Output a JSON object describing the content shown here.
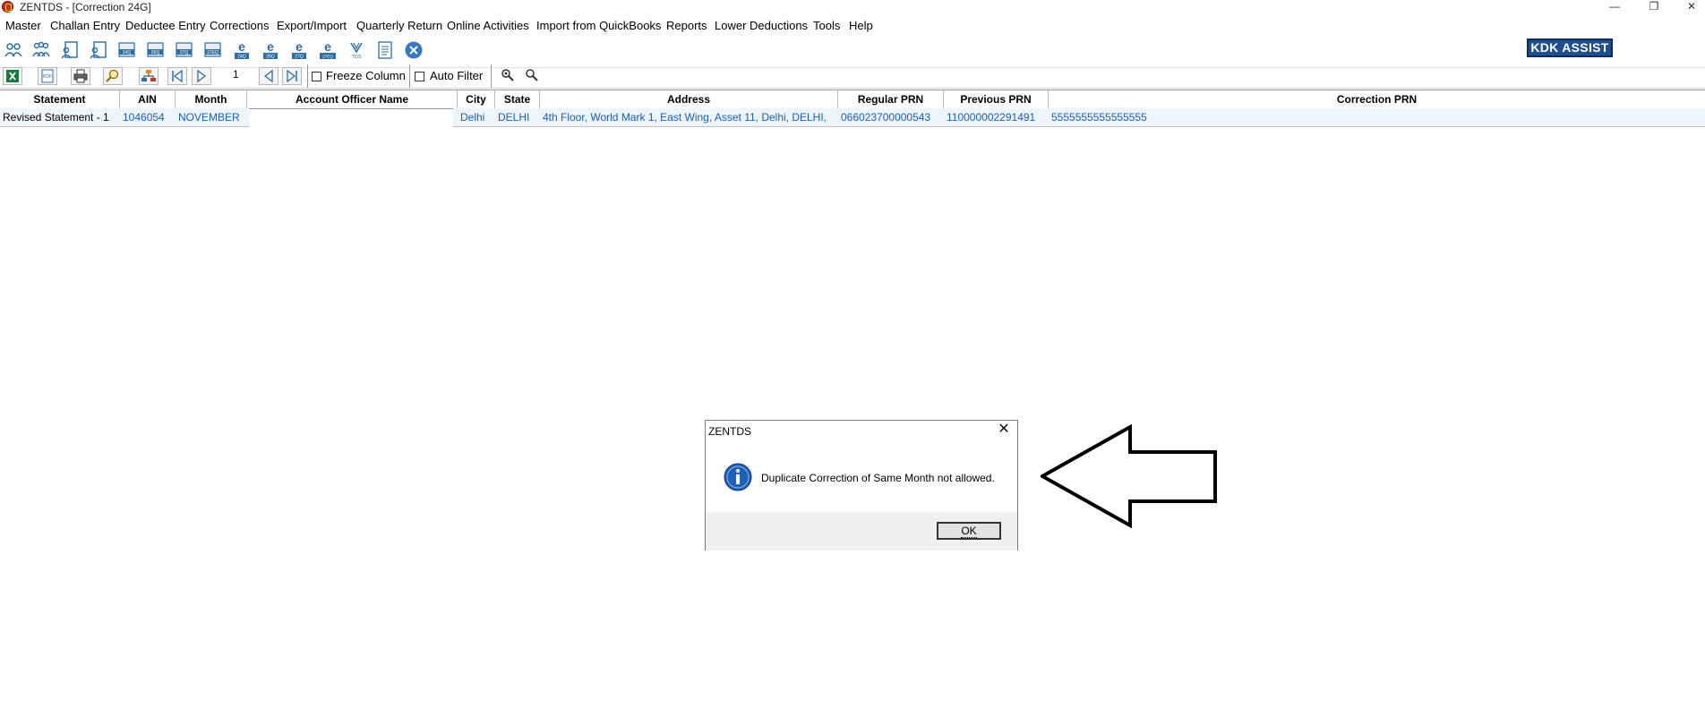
{
  "window": {
    "title": "ZENTDS - [Correction 24G]",
    "minimize": "—",
    "restore": "❐",
    "close": "✕"
  },
  "menu": [
    "Master",
    "Challan Entry",
    "Deductee Entry",
    "Corrections",
    "Export/Import",
    "Quarterly Return",
    "Online Activities",
    "Import from QuickBooks",
    "Reports",
    "Lower Deductions",
    "Tools",
    "Help"
  ],
  "toolbar": {
    "kdk_label": "KDK ASSIST",
    "icons": [
      "users-icon",
      "group-icon",
      "deductor-icon",
      "deductee-icon",
      "form-24q-icon",
      "form-26q-icon",
      "form-27q-icon",
      "form-27eq-icon",
      "e-24q-icon",
      "e-26q-icon",
      "e-27q-icon",
      "e-27eq-icon",
      "tds-icon",
      "document-icon",
      "close-circle-icon"
    ]
  },
  "toolbar2": {
    "page_number": "1",
    "freeze_column_label": "Freeze Column",
    "auto_filter_label": "Auto Filter"
  },
  "grid": {
    "headers": [
      "Statement",
      "AIN",
      "Month",
      "Account Officer Name",
      "City",
      "State",
      "Address",
      "Regular PRN",
      "Previous PRN",
      "Correction PRN"
    ],
    "row": {
      "statement": "Revised Statement - 1",
      "ain": "1046054",
      "month": "NOVEMBER",
      "account_officer_name": "",
      "city": "Delhi",
      "state": "DELHI",
      "address": "4th Floor, World Mark 1, East Wing, Asset 11, Delhi, DELHI,",
      "regular_prn": "066023700000543",
      "previous_prn": "110000002291491",
      "correction_prn": "5555555555555555"
    }
  },
  "dialog": {
    "title": "ZENTDS",
    "message": "Duplicate Correction of Same Month not allowed.",
    "ok_label": "OK",
    "icon": "info-icon"
  }
}
